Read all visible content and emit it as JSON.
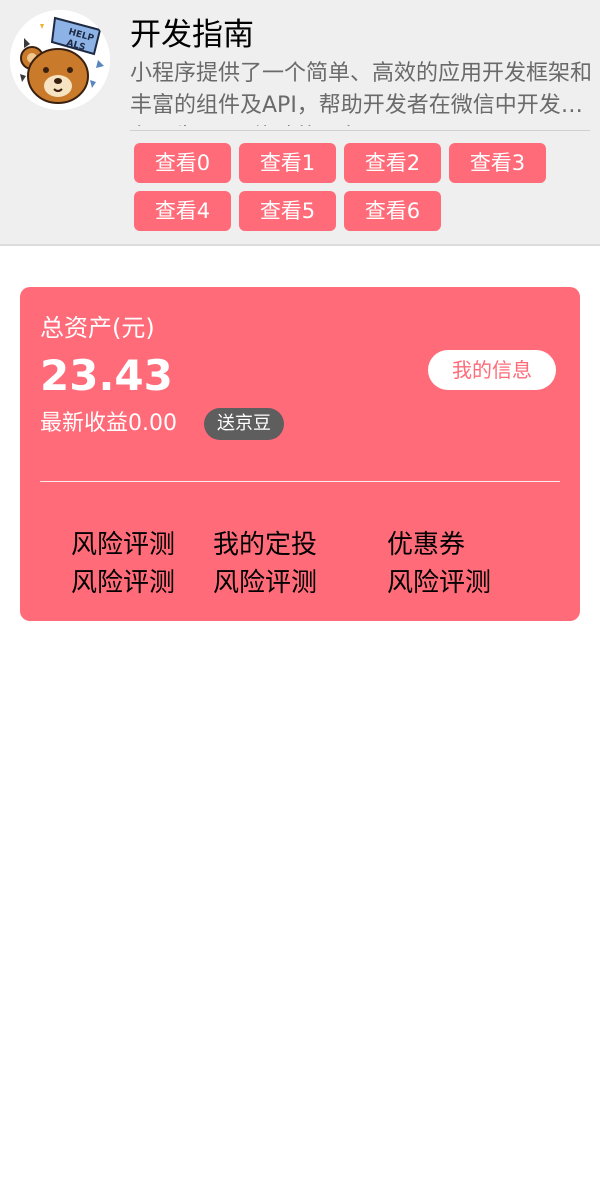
{
  "header": {
    "title": "开发指南",
    "description": "小程序提供了一个简单、高效的应用开发框架和丰富的组件及API，帮助开发者在微信中开发具有原生 APP 体验的服务。",
    "avatar_badge": "HELP ALS",
    "buttons": [
      "查看0",
      "查看1",
      "查看2",
      "查看3",
      "查看4",
      "查看5",
      "查看6"
    ]
  },
  "assets": {
    "label": "总资产(元)",
    "amount": "23.43",
    "info_button": "我的信息",
    "earnings": "最新收益0.00",
    "bean_badge": "送京豆",
    "menu": [
      "风险评测",
      "我的定投",
      "优惠券",
      "风险评测",
      "风险评测",
      "风险评测"
    ]
  },
  "colors": {
    "accent": "#ff6b78",
    "header_bg": "#efefef",
    "badge_bg": "#5e5e5e"
  }
}
